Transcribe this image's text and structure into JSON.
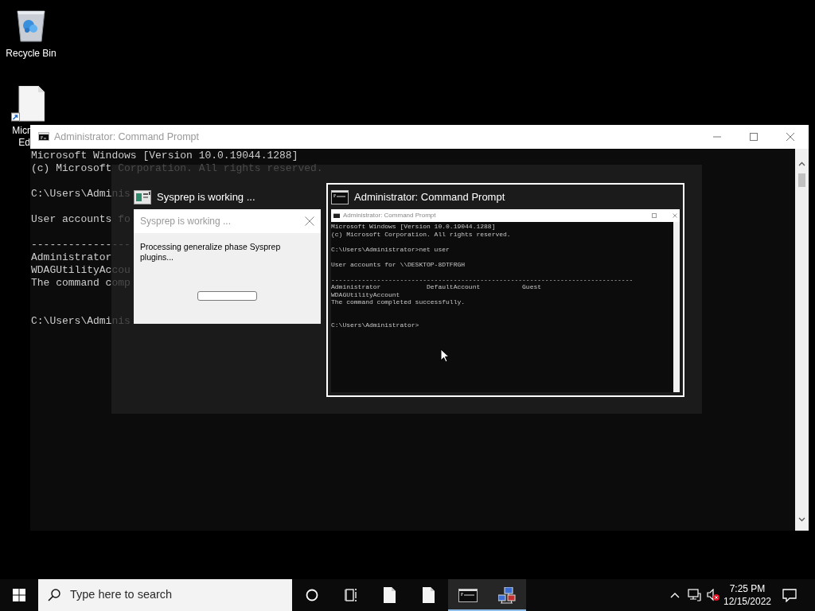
{
  "desktop_icons": [
    {
      "kind": "recycle_bin",
      "label_lines": [
        "Recycle Bin"
      ]
    },
    {
      "kind": "shortcut",
      "label_lines": [
        "Micr",
        "Ed"
      ]
    }
  ],
  "console_window": {
    "title": "Administrator: Command Prompt",
    "active": false,
    "lines": [
      {
        "text": "Microsoft Windows [Version 10.0.19044.1288]"
      },
      {
        "text": "(c) Microsoft",
        "faded": " Corporation. All rights reserved."
      },
      {
        "kind": "blank"
      },
      {
        "text": "C:\\Users\\Admi",
        "faded": "nis"
      },
      {
        "kind": "blank"
      },
      {
        "text": "User accounts",
        "faded": " fo"
      },
      {
        "kind": "blank"
      },
      {
        "text": "-------------",
        "faded": "---"
      },
      {
        "text": "Administrator"
      },
      {
        "text": "WDAGUtilityAc",
        "faded": "cou"
      },
      {
        "text": "The command c",
        "faded": "omp"
      },
      {
        "kind": "blank"
      },
      {
        "kind": "blank"
      },
      {
        "text": "C:\\Users\\Admi",
        "faded": "nis"
      }
    ]
  },
  "task_switcher": {
    "items": [
      {
        "kind": "dialog",
        "title": "Sysprep is working ...",
        "selected": false,
        "thumbnail": {
          "title": "Sysprep is working ...",
          "message": "Processing generalize phase Sysprep plugins...",
          "level": 0
        }
      },
      {
        "kind": "console",
        "title": "Administrator: Command Prompt",
        "selected": true,
        "thumbnail": {
          "title": "Administrator: Command Prompt",
          "lines": [
            {
              "text": "Microsoft Windows [Version 10.0.19044.1288]"
            },
            {
              "text": "(c) Microsoft Corporation. All rights reserved."
            },
            {
              "kind": "blank"
            },
            {
              "text": "C:\\Users\\Administrator>net user"
            },
            {
              "kind": "blank"
            },
            {
              "text": "User accounts for \\\\DESKTOP-8DTFRGH"
            },
            {
              "kind": "blank"
            },
            {
              "text": "-------------------------------------------------------------------------------"
            },
            {
              "text": "Administrator            DefaultAccount           Guest"
            },
            {
              "text": "WDAGUtilityAccount"
            },
            {
              "text": "The command completed successfully."
            },
            {
              "kind": "blank"
            },
            {
              "kind": "blank"
            },
            {
              "text": "C:\\Users\\Administrator>"
            }
          ]
        }
      }
    ]
  },
  "taskbar": {
    "search": {
      "placeholder": "Type here to search"
    },
    "apps": [
      {
        "kind": "document",
        "active": false
      },
      {
        "kind": "document",
        "active": false
      },
      {
        "kind": "console",
        "active": true
      },
      {
        "kind": "network",
        "active": true
      }
    ],
    "tray": {
      "volume_muted": true,
      "time": "7:25 PM",
      "date": "12/15/2022"
    }
  }
}
